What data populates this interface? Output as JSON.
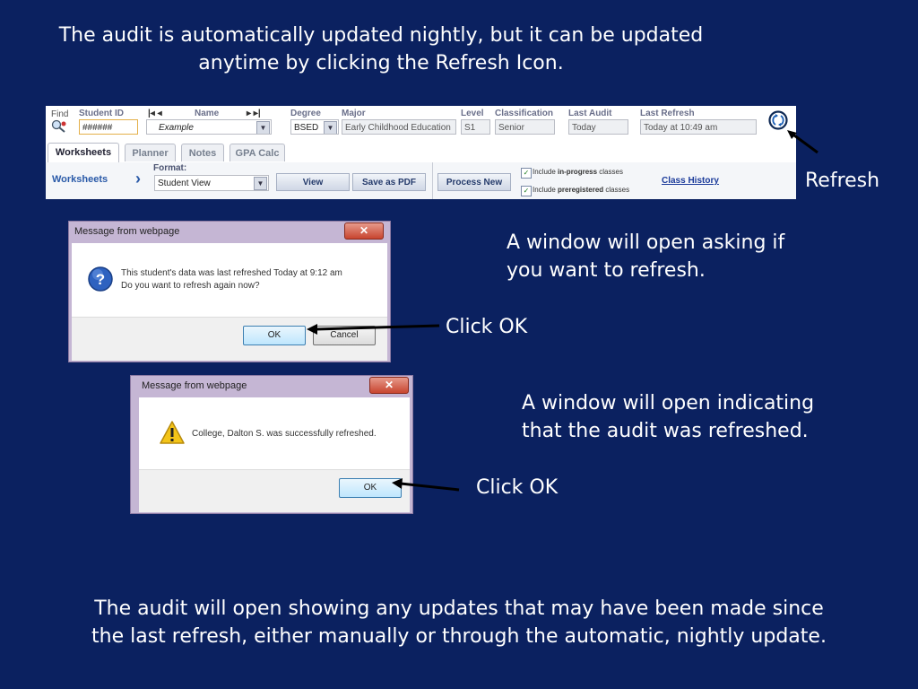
{
  "slide": {
    "top_line1": "The audit is automatically updated nightly, but it can be updated",
    "top_line2": "anytime by clicking the Refresh Icon.",
    "refresh_label": "Refresh",
    "note1_line1": "A window will open asking if",
    "note1_line2": "you want to refresh.",
    "click_ok_1": "Click OK",
    "note2_line1": "A window will open indicating",
    "note2_line2": "that the audit was refreshed.",
    "click_ok_2": "Click OK",
    "bottom_line1": "The audit will open showing any updates that may have been made since",
    "bottom_line2": "the last refresh, either manually or through the automatic, nightly update."
  },
  "toolbar": {
    "find_label": "Find",
    "student_id_label": "Student ID",
    "student_id_value": "######",
    "name_label": "Name",
    "name_value": "Example",
    "degree_label": "Degree",
    "degree_value": "BSED",
    "major_label": "Major",
    "major_value": "Early Childhood Education",
    "level_label": "Level",
    "level_value": "S1",
    "classification_label": "Classification",
    "classification_value": "Senior",
    "last_audit_label": "Last Audit",
    "last_audit_value": "Today",
    "last_refresh_label": "Last Refresh",
    "last_refresh_value": "Today at 10:49 am",
    "tabs": [
      "Worksheets",
      "Planner",
      "Notes",
      "GPA Calc"
    ],
    "worksheets_label": "Worksheets",
    "format_label": "Format:",
    "format_value": "Student View",
    "view_button": "View",
    "save_pdf_button": "Save as PDF",
    "process_new_button": "Process New",
    "include_label": "Include",
    "in_progress_label": "in-progress",
    "preregistered_label": "preregistered",
    "classes_label": "classes",
    "class_history_link": "Class History"
  },
  "dialog1": {
    "title": "Message from webpage",
    "line1": "This student's data was last refreshed Today at 9:12 am",
    "line2": "Do you want to refresh again now?",
    "ok": "OK",
    "cancel": "Cancel"
  },
  "dialog2": {
    "title": "Message from webpage",
    "message": "College, Dalton S. was successfully refreshed.",
    "ok": "OK"
  }
}
